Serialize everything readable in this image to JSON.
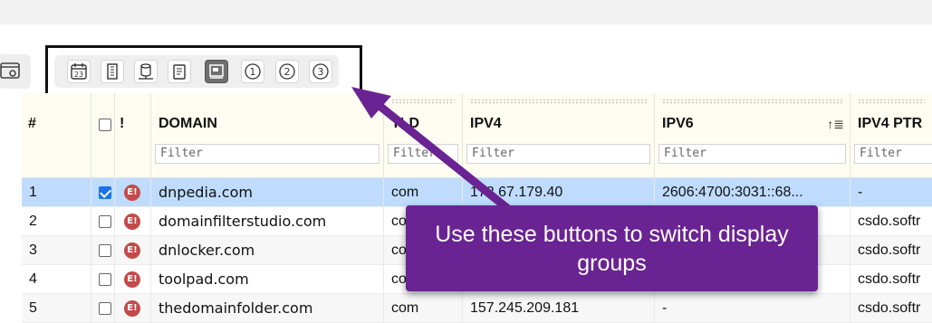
{
  "toolbar": {
    "buttons": [
      {
        "name": "calendar-icon",
        "label": "23"
      },
      {
        "name": "building-icon",
        "label": ""
      },
      {
        "name": "database-icon",
        "label": ""
      },
      {
        "name": "notes-icon",
        "label": ""
      },
      {
        "name": "display-icon",
        "label": "",
        "active": true
      },
      {
        "name": "group-1-icon",
        "label": "1"
      },
      {
        "name": "group-2-icon",
        "label": "2"
      },
      {
        "name": "group-3-icon",
        "label": "3"
      }
    ]
  },
  "grid": {
    "columns": {
      "num": "#",
      "flag": "!",
      "domain": "DOMAIN",
      "tld": "TLD",
      "ipv4": "IPV4",
      "ipv6": "IPV6",
      "ipv4ptr": "IPV4 PTR"
    },
    "filter_placeholder": "Filter",
    "rows": [
      {
        "num": "1",
        "checked": true,
        "domain": "dnpedia.com",
        "tld": "com",
        "ipv4": "172.67.179.40",
        "ipv6": "2606:4700:3031::68...",
        "ptr": "-"
      },
      {
        "num": "2",
        "checked": false,
        "domain": "domainfilterstudio.com",
        "tld": "com",
        "ipv4": "",
        "ipv6": "",
        "ptr": "csdo.softr"
      },
      {
        "num": "3",
        "checked": false,
        "domain": "dnlocker.com",
        "tld": "com",
        "ipv4": "",
        "ipv6": "",
        "ptr": "csdo.softr"
      },
      {
        "num": "4",
        "checked": false,
        "domain": "toolpad.com",
        "tld": "com",
        "ipv4": "",
        "ipv6": "",
        "ptr": "csdo.softr"
      },
      {
        "num": "5",
        "checked": false,
        "domain": "thedomainfolder.com",
        "tld": "com",
        "ipv4": "157.245.209.181",
        "ipv6": "-",
        "ptr": "csdo.softr"
      }
    ],
    "badge_text": "E!"
  },
  "callout": {
    "text": "Use these buttons to switch display groups"
  },
  "colors": {
    "callout_bg": "#6a2392",
    "selected_row": "#bfdcff",
    "badge": "#c44a4a"
  }
}
